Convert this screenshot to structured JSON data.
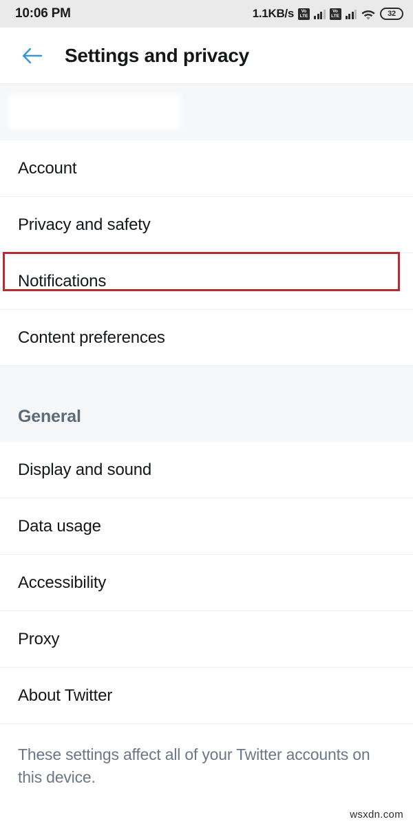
{
  "statusbar": {
    "clock": "10:06 PM",
    "network_speed": "1.1KB/s",
    "volte_top": "Vo",
    "volte_bottom": "LTE",
    "battery_level": "32",
    "icons": [
      "volte-icon",
      "signal-bars-icon",
      "volte-icon",
      "signal-bars-icon",
      "wifi-icon",
      "battery-icon"
    ],
    "background_color": "#eaeaea"
  },
  "appbar": {
    "back_icon": "arrow-left-icon",
    "back_icon_color": "#3b97d3",
    "title": "Settings and privacy"
  },
  "sections": [
    {
      "header": "",
      "redacted": true,
      "items": [
        {
          "label": "Account",
          "highlighted": false
        },
        {
          "label": "Privacy and safety",
          "highlighted": false
        },
        {
          "label": "Notifications",
          "highlighted": true
        },
        {
          "label": "Content preferences",
          "highlighted": false
        }
      ]
    },
    {
      "header": "General",
      "redacted": false,
      "items": [
        {
          "label": "Display and sound",
          "highlighted": false
        },
        {
          "label": "Data usage",
          "highlighted": false
        },
        {
          "label": "Accessibility",
          "highlighted": false
        },
        {
          "label": "Proxy",
          "highlighted": false
        },
        {
          "label": "About Twitter",
          "highlighted": false
        }
      ]
    }
  ],
  "footer": {
    "text": "These settings affect all of your Twitter accounts on this device."
  },
  "annotation": {
    "target": "Notifications",
    "color": "#b72b31"
  },
  "watermark": "wsxdn.com",
  "theme": {
    "page_background": "#ffffff",
    "section_background": "#f6f7f9",
    "divider": "#eceef0",
    "primary_text": "#14171a",
    "secondary_text": "#6b7785",
    "section_header_text": "#5c6b7a",
    "accent_blue": "#3b97d3"
  }
}
